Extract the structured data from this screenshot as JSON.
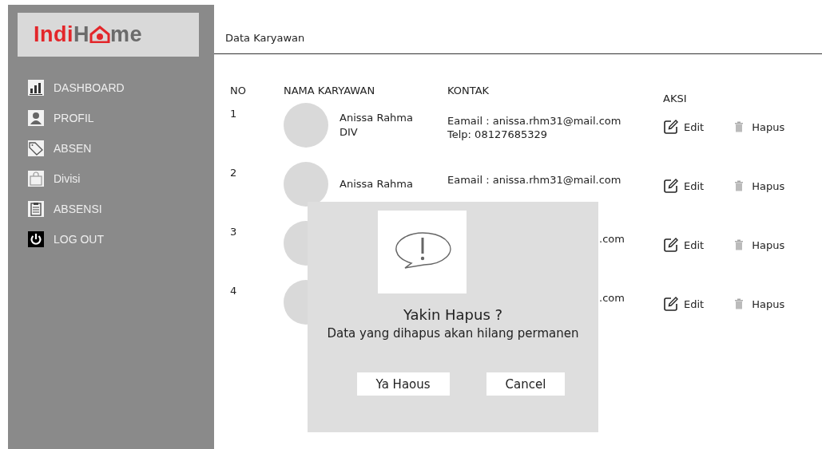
{
  "sidebar": {
    "logo": {
      "part_1": "Indi",
      "part_2": "H",
      "part_3": "me"
    },
    "items": [
      {
        "label": "DASHBOARD"
      },
      {
        "label": "PROFIL"
      },
      {
        "label": "ABSEN"
      },
      {
        "label": "Divisi"
      },
      {
        "label": "ABSENSI"
      },
      {
        "label": "LOG OUT"
      }
    ]
  },
  "page_title": "Data Karyawan",
  "table": {
    "columns": [
      "NO",
      "NAMA KARYAWAN",
      "KONTAK",
      "AKSI"
    ],
    "rows": [
      {
        "no": "1",
        "name": "Anissa Rahma",
        "division": "DIV",
        "email": "Eamail : anissa.rhm31@mail.com",
        "phone": "Telp: 08127685329",
        "edit": "Edit",
        "delete": "Hapus"
      },
      {
        "no": "2",
        "name": "Anissa Rahma",
        "email": "Eamail : anissa.rhm31@mail.com",
        "edit": "Edit",
        "delete": "Hapus"
      },
      {
        "no": "3",
        "email_tail": ".com",
        "edit": "Edit",
        "delete": "Hapus"
      },
      {
        "no": "4",
        "email_tail": ".com",
        "edit": "Edit",
        "delete": "Hapus"
      }
    ]
  },
  "dialog": {
    "title": "Yakin Hapus ?",
    "message": "Data yang dihapus akan hilang permanen",
    "buttons": [
      "Ya Haous",
      "Cancel"
    ]
  }
}
